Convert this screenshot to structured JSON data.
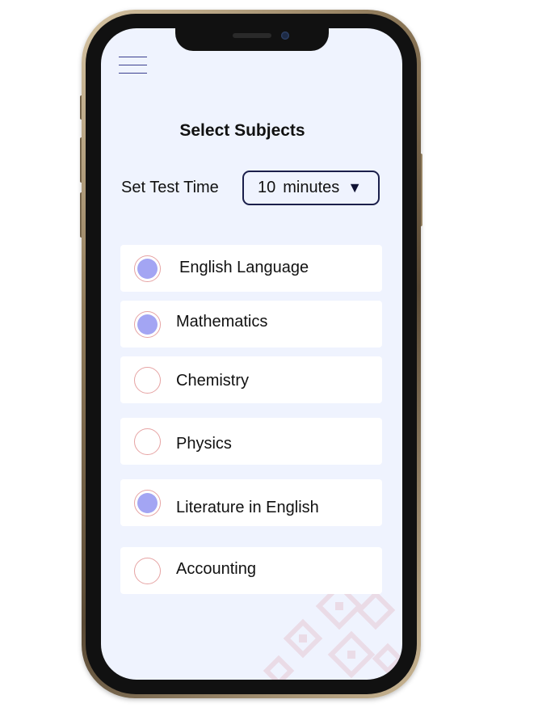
{
  "page": {
    "title": "Select Subjects"
  },
  "test_time": {
    "label": "Set Test Time",
    "value": "10",
    "unit": "minutes",
    "caret": "▼"
  },
  "subjects": [
    {
      "label": "English Language",
      "selected": true
    },
    {
      "label": "Mathematics",
      "selected": true
    },
    {
      "label": "Chemistry",
      "selected": false
    },
    {
      "label": "Physics",
      "selected": false
    },
    {
      "label": "Literature in English",
      "selected": true
    },
    {
      "label": "Accounting",
      "selected": false
    }
  ],
  "colors": {
    "screen_background": "#eff3fe",
    "radio_fill": "#a3a5f3",
    "radio_border": "#e6a3a3",
    "accent_dark": "#1b1f4b"
  },
  "icons": {
    "menu": "hamburger-menu-icon",
    "dropdown": "caret-down-icon"
  }
}
